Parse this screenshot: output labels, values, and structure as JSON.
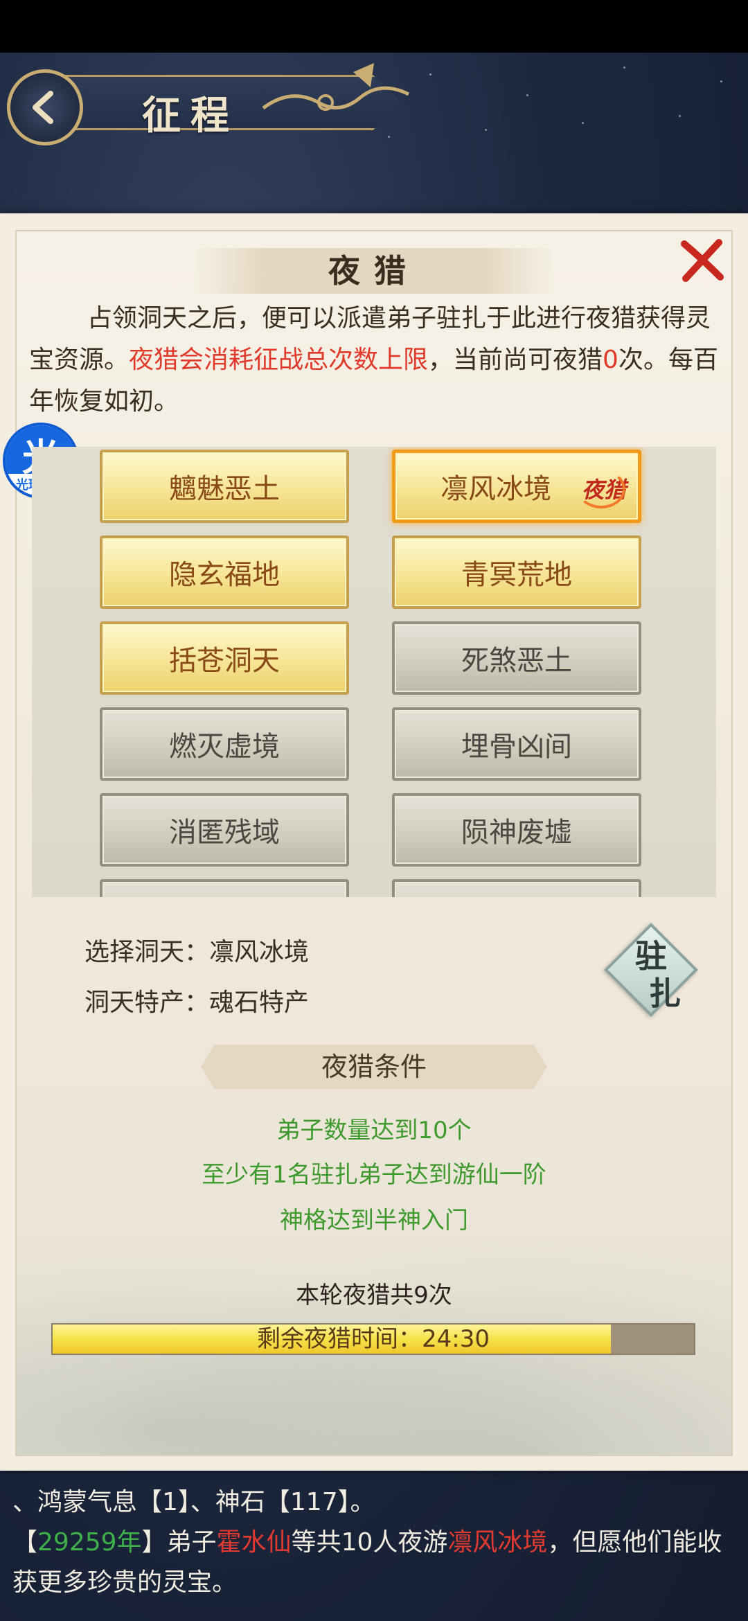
{
  "header": {
    "title": "征程",
    "back_icon": "chevron-left-icon"
  },
  "dialog": {
    "title": "夜猎",
    "close_icon": "close-x-icon",
    "intro": {
      "part1": "占领洞天之后，便可以派遣弟子驻扎于此进行夜猎获得灵宝资源。",
      "red1": "夜猎会消耗征战总次数上限",
      "part2": "，当前尚可夜猎",
      "red2": "0",
      "part3": "次。每百年恢复如初。"
    },
    "regions": [
      {
        "label": "魑魅恶土",
        "state": "unlocked"
      },
      {
        "label": "凛风冰境",
        "state": "selected",
        "stamp": "夜猎"
      },
      {
        "label": "隐玄福地",
        "state": "unlocked"
      },
      {
        "label": "青冥荒地",
        "state": "unlocked"
      },
      {
        "label": "括苍洞天",
        "state": "unlocked"
      },
      {
        "label": "死煞恶土",
        "state": "locked"
      },
      {
        "label": "燃灭虚境",
        "state": "locked"
      },
      {
        "label": "埋骨凶间",
        "state": "locked"
      },
      {
        "label": "消匿残域",
        "state": "locked"
      },
      {
        "label": "陨神废墟",
        "state": "locked"
      }
    ],
    "selected_label": "选择洞天：",
    "selected_value": "凛风冰境",
    "specialty_label": "洞天特产：",
    "specialty_value": "魂石特产",
    "garrison_button": [
      "驻",
      "扎"
    ],
    "conditions_title": "夜猎条件",
    "conditions": [
      "弟子数量达到10个",
      "至少有1名驻扎弟子达到游仙一阶",
      "神格达到半神入门"
    ],
    "round_count": "本轮夜猎共9次",
    "timer_label": "剩余夜猎时间：24:30",
    "timer_progress": 0.87
  },
  "helper": {
    "char": "光",
    "text": "光环助手"
  },
  "log": {
    "line1": "、鸿蒙气息【1】、神石【117】。",
    "line2_a": "【",
    "line2_year": "29259年",
    "line2_b": "】弟子",
    "line2_name": "霍水仙",
    "line2_c": "等共10人夜游",
    "line2_place": "凛风冰境",
    "line2_d": "，但愿他们能收获更多珍贵的灵宝。"
  },
  "colors": {
    "accent_red": "#e03b2a",
    "condition_green": "#3f9a2e",
    "gold_tile": "#f6e595",
    "locked_tile": "#cfccbe",
    "selected_border": "#f09a1a"
  }
}
